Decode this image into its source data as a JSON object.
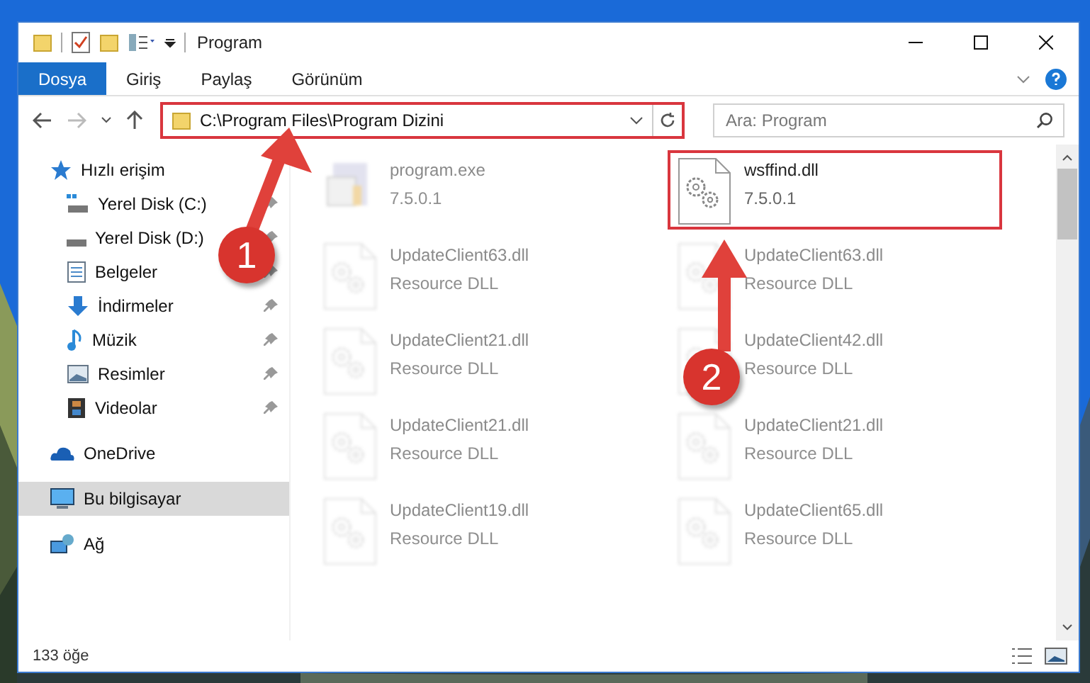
{
  "window": {
    "title": "Program"
  },
  "ribbon_tabs": [
    {
      "label": "Dosya",
      "selected": true
    },
    {
      "label": "Giriş",
      "selected": false
    },
    {
      "label": "Paylaş",
      "selected": false
    },
    {
      "label": "Görünüm",
      "selected": false
    }
  ],
  "address_bar": {
    "path": "C:\\Program Files\\Program Dizini",
    "highlighted": true
  },
  "search": {
    "placeholder": "Ara: Program"
  },
  "sidebar": {
    "items": [
      {
        "label": "Hızlı erişim",
        "selected": false,
        "children": [
          {
            "label": "Yerel Disk (C:)",
            "selected": false
          },
          {
            "label": "Yerel Disk (D:)",
            "selected": false
          },
          {
            "label": "Belgeler",
            "selected": false
          },
          {
            "label": "İndirmeler",
            "selected": false
          },
          {
            "label": "Müzik",
            "selected": false
          },
          {
            "label": "Resimler",
            "selected": false
          },
          {
            "label": "Videolar",
            "selected": false
          }
        ]
      },
      {
        "label": "OneDrive",
        "selected": false
      },
      {
        "label": "Bu bilgisayar",
        "selected": true
      },
      {
        "label": "Ağ",
        "selected": false
      }
    ]
  },
  "files": [
    {
      "kind": "exe",
      "name": "program.exe",
      "detail": "7.5.0.1",
      "faded": true,
      "highlighted": false
    },
    {
      "kind": "dll",
      "name": "wsffind.dll",
      "detail": "7.5.0.1",
      "faded": false,
      "highlighted": true
    },
    {
      "kind": "dll",
      "name": "UpdateClient63.dll",
      "detail": "Resource DLL",
      "faded": true,
      "highlighted": false
    },
    {
      "kind": "dll",
      "name": "UpdateClient63.dll",
      "detail": "Resource DLL",
      "faded": true,
      "highlighted": false
    },
    {
      "kind": "dll",
      "name": "UpdateClient21.dll",
      "detail": "Resource DLL",
      "faded": true,
      "highlighted": false
    },
    {
      "kind": "dll",
      "name": "UpdateClient42.dll",
      "detail": "Resource DLL",
      "faded": true,
      "highlighted": false
    },
    {
      "kind": "dll",
      "name": "UpdateClient21.dll",
      "detail": "Resource DLL",
      "faded": true,
      "highlighted": false
    },
    {
      "kind": "dll",
      "name": "UpdateClient21.dll",
      "detail": "Resource DLL",
      "faded": true,
      "highlighted": false
    },
    {
      "kind": "dll",
      "name": "UpdateClient19.dll",
      "detail": "Resource DLL",
      "faded": true,
      "highlighted": false
    },
    {
      "kind": "dll",
      "name": "UpdateClient65.dll",
      "detail": "Resource DLL",
      "faded": true,
      "highlighted": false
    }
  ],
  "status_bar": {
    "count": "133 öğe"
  },
  "annotations": [
    {
      "number": "1"
    },
    {
      "number": "2"
    }
  ]
}
